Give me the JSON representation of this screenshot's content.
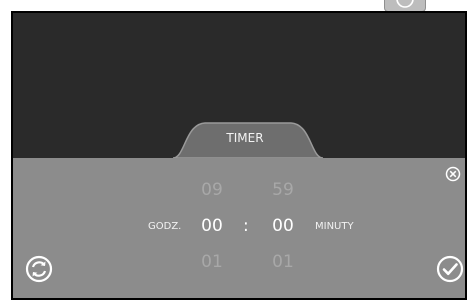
{
  "tab": {
    "label": "TIMER"
  },
  "timer": {
    "hours": {
      "label": "GODZ.",
      "prev": "09",
      "current": "00",
      "next": "01"
    },
    "separator": ":",
    "minutes": {
      "label": "MINUTY",
      "prev": "59",
      "current": "00",
      "next": "01"
    }
  },
  "icons": {
    "top": "check-circle-icon",
    "close": "close-circle-icon",
    "reset": "refresh-circle-icon",
    "confirm": "check-circle-icon"
  },
  "colors": {
    "screen_background": "#2a2a2a",
    "panel_background": "#8c8c8c",
    "tab_background": "#6e6e6e",
    "text_primary": "#ffffff",
    "text_faded": "#a8a8a8"
  }
}
